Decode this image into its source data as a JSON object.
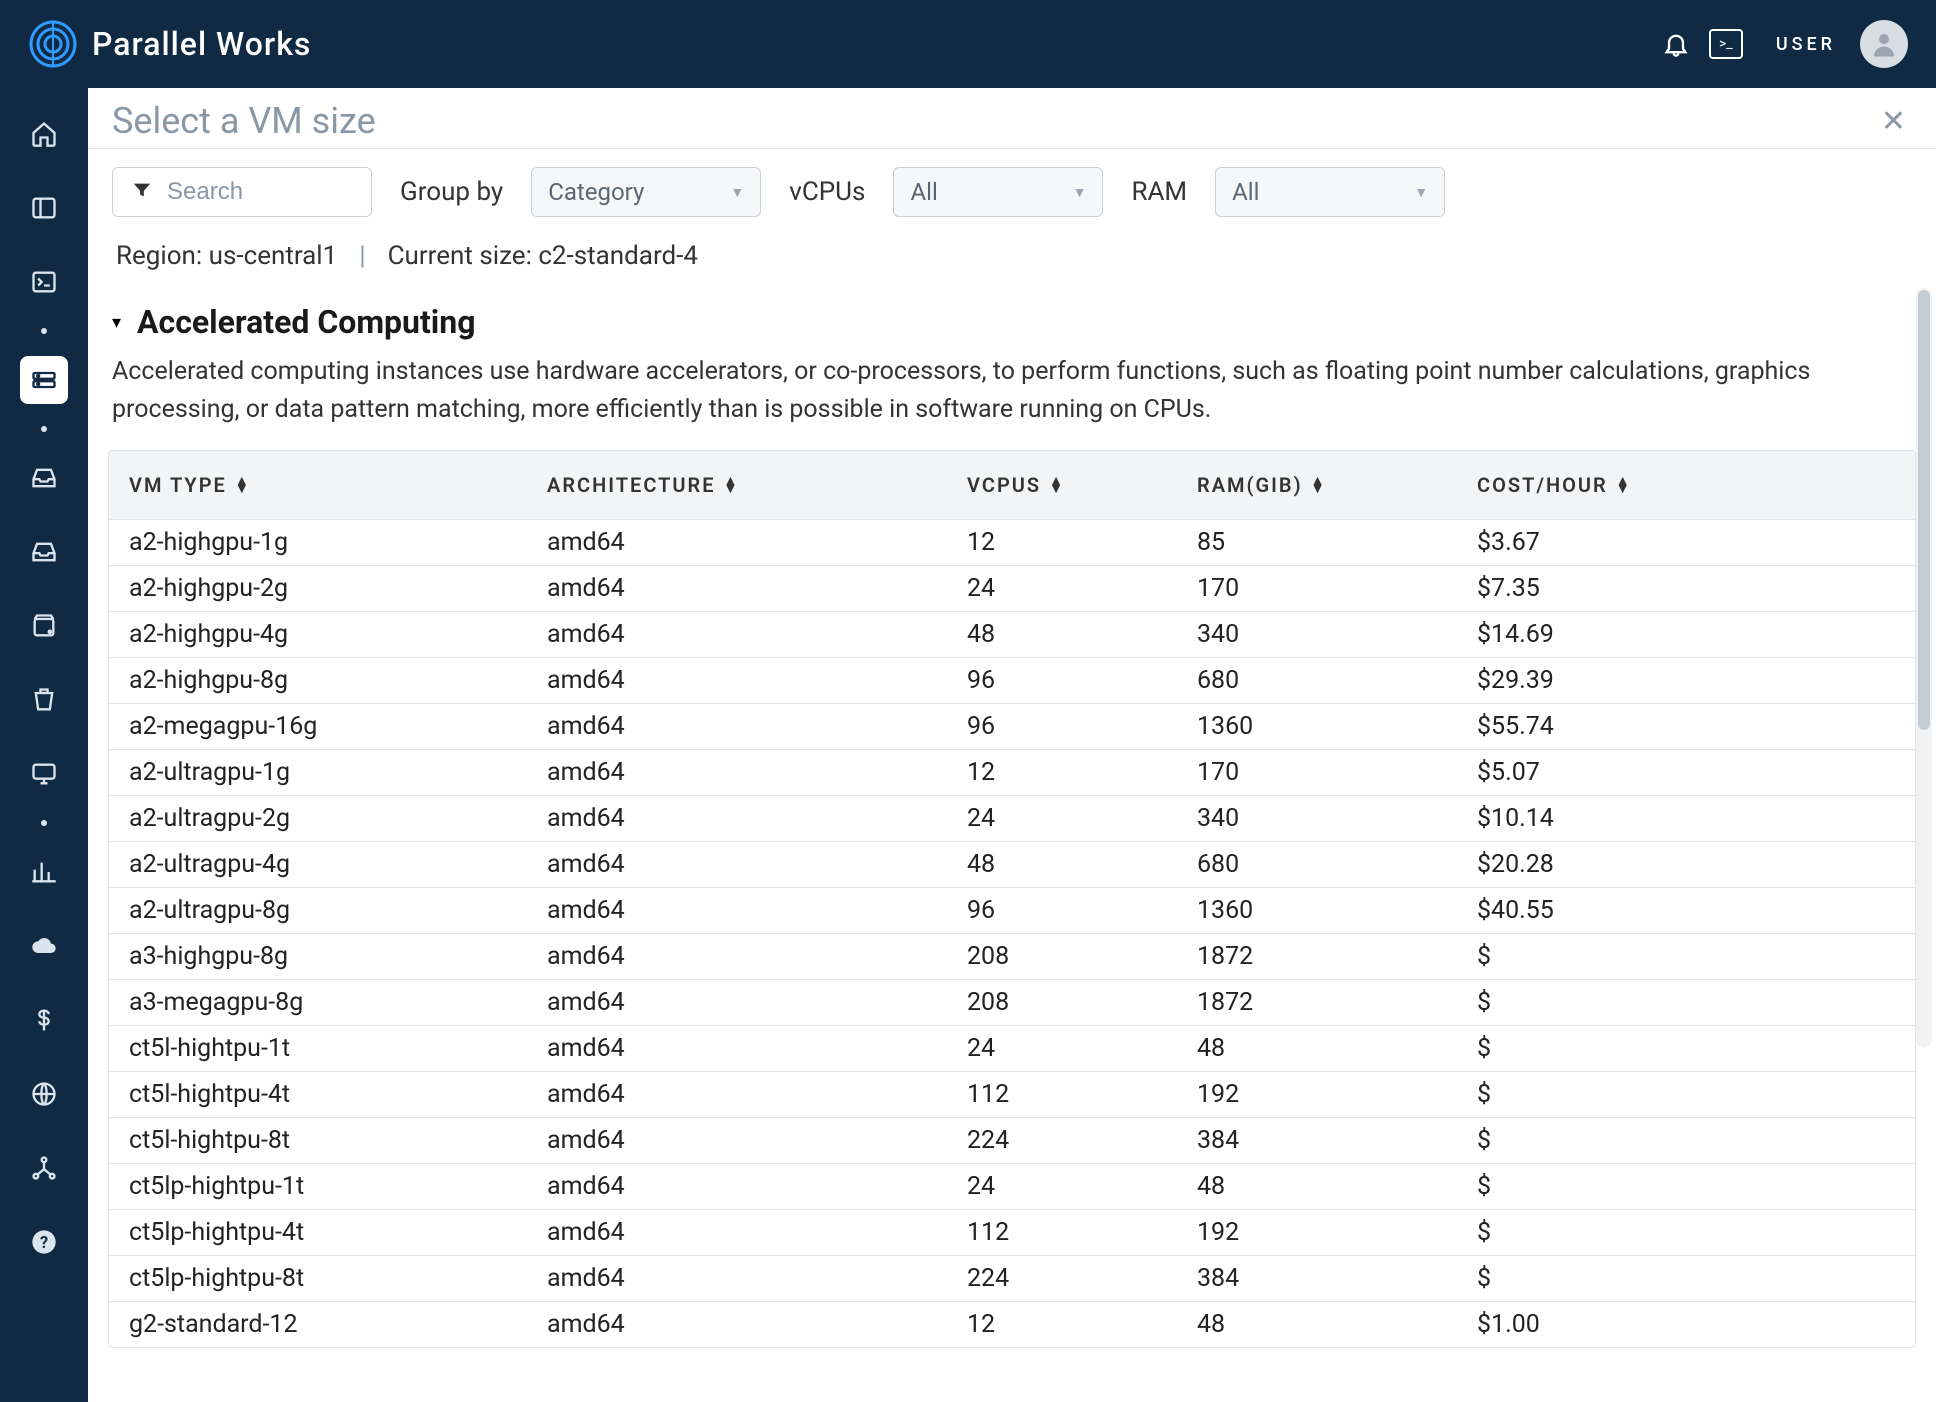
{
  "brand": {
    "name": "Parallel Works"
  },
  "topbar": {
    "user_label": "USER"
  },
  "page": {
    "title": "Select a VM size",
    "search_placeholder": "Search",
    "group_by_label": "Group by",
    "group_by_value": "Category",
    "vcpus_label": "vCPUs",
    "vcpus_value": "All",
    "ram_label": "RAM",
    "ram_value": "All",
    "region_label": "Region: us-central1",
    "current_size_label": "Current size: c2-standard-4"
  },
  "group": {
    "title": "Accelerated Computing",
    "description": "Accelerated computing instances use hardware accelerators, or co-processors, to perform functions, such as floating point number calculations, graphics processing, or data pattern matching, more efficiently than is possible in software running on CPUs."
  },
  "columns": {
    "vm": "VM TYPE",
    "arch": "ARCHITECTURE",
    "vcpu": "VCPUS",
    "ram": "RAM(GIB)",
    "cost": "COST/HOUR"
  },
  "rows": [
    {
      "vm": "a2-highgpu-1g",
      "arch": "amd64",
      "vcpu": "12",
      "ram": "85",
      "cost": "$3.67"
    },
    {
      "vm": "a2-highgpu-2g",
      "arch": "amd64",
      "vcpu": "24",
      "ram": "170",
      "cost": "$7.35"
    },
    {
      "vm": "a2-highgpu-4g",
      "arch": "amd64",
      "vcpu": "48",
      "ram": "340",
      "cost": "$14.69"
    },
    {
      "vm": "a2-highgpu-8g",
      "arch": "amd64",
      "vcpu": "96",
      "ram": "680",
      "cost": "$29.39"
    },
    {
      "vm": "a2-megagpu-16g",
      "arch": "amd64",
      "vcpu": "96",
      "ram": "1360",
      "cost": "$55.74"
    },
    {
      "vm": "a2-ultragpu-1g",
      "arch": "amd64",
      "vcpu": "12",
      "ram": "170",
      "cost": "$5.07"
    },
    {
      "vm": "a2-ultragpu-2g",
      "arch": "amd64",
      "vcpu": "24",
      "ram": "340",
      "cost": "$10.14"
    },
    {
      "vm": "a2-ultragpu-4g",
      "arch": "amd64",
      "vcpu": "48",
      "ram": "680",
      "cost": "$20.28"
    },
    {
      "vm": "a2-ultragpu-8g",
      "arch": "amd64",
      "vcpu": "96",
      "ram": "1360",
      "cost": "$40.55"
    },
    {
      "vm": "a3-highgpu-8g",
      "arch": "amd64",
      "vcpu": "208",
      "ram": "1872",
      "cost": "$"
    },
    {
      "vm": "a3-megagpu-8g",
      "arch": "amd64",
      "vcpu": "208",
      "ram": "1872",
      "cost": "$"
    },
    {
      "vm": "ct5l-hightpu-1t",
      "arch": "amd64",
      "vcpu": "24",
      "ram": "48",
      "cost": "$"
    },
    {
      "vm": "ct5l-hightpu-4t",
      "arch": "amd64",
      "vcpu": "112",
      "ram": "192",
      "cost": "$"
    },
    {
      "vm": "ct5l-hightpu-8t",
      "arch": "amd64",
      "vcpu": "224",
      "ram": "384",
      "cost": "$"
    },
    {
      "vm": "ct5lp-hightpu-1t",
      "arch": "amd64",
      "vcpu": "24",
      "ram": "48",
      "cost": "$"
    },
    {
      "vm": "ct5lp-hightpu-4t",
      "arch": "amd64",
      "vcpu": "112",
      "ram": "192",
      "cost": "$"
    },
    {
      "vm": "ct5lp-hightpu-8t",
      "arch": "amd64",
      "vcpu": "224",
      "ram": "384",
      "cost": "$"
    },
    {
      "vm": "g2-standard-12",
      "arch": "amd64",
      "vcpu": "12",
      "ram": "48",
      "cost": "$1.00"
    }
  ]
}
